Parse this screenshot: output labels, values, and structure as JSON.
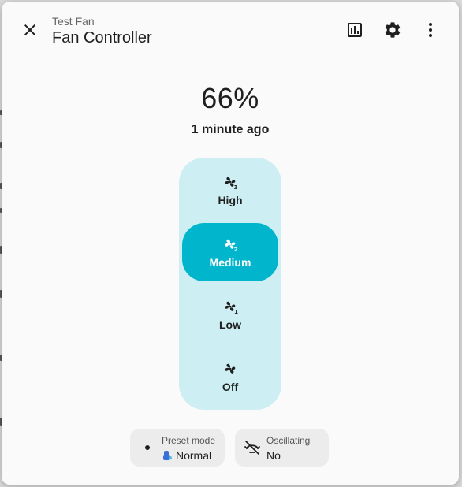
{
  "header": {
    "subtitle": "Test Fan",
    "title": "Fan Controller"
  },
  "state": {
    "value": "66%",
    "last_changed": "1 minute ago"
  },
  "modes": [
    {
      "label": "High",
      "icon": "fan-speed-3-icon",
      "active": false
    },
    {
      "label": "Medium",
      "icon": "fan-speed-2-icon",
      "active": true
    },
    {
      "label": "Low",
      "icon": "fan-speed-1-icon",
      "active": false
    },
    {
      "label": "Off",
      "icon": "fan-off-icon",
      "active": false
    }
  ],
  "chips": {
    "preset": {
      "label": "Preset mode",
      "value": "Normal"
    },
    "oscillating": {
      "label": "Oscillating",
      "value": "No"
    }
  },
  "colors": {
    "accent": "#00b5cc",
    "control_track": "#cdeef3"
  }
}
